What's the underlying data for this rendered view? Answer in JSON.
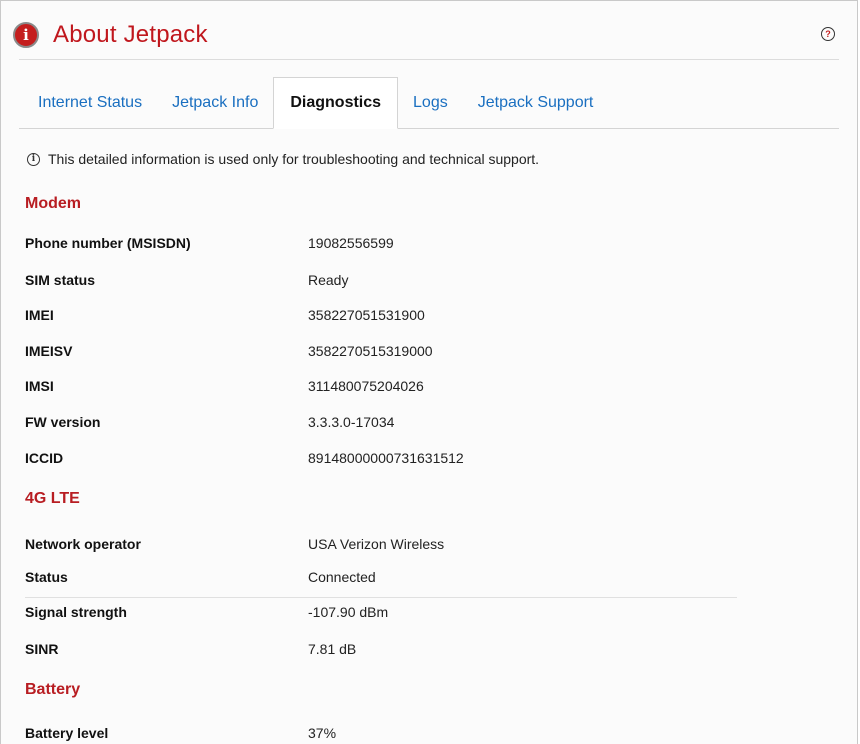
{
  "header": {
    "title": "About Jetpack",
    "info_icon": "info-icon",
    "help_icon": "question-circle-icon",
    "accent_color": "#c0171d"
  },
  "tabs": [
    {
      "label": "Internet Status",
      "active": false
    },
    {
      "label": "Jetpack Info",
      "active": false
    },
    {
      "label": "Diagnostics",
      "active": true
    },
    {
      "label": "Logs",
      "active": false
    },
    {
      "label": "Jetpack Support",
      "active": false
    }
  ],
  "notice": {
    "text": "This detailed information is used only for troubleshooting and technical support."
  },
  "sections": {
    "modem": {
      "title": "Modem",
      "rows": [
        {
          "label": "Phone number (MSISDN)",
          "value": "19082556599"
        },
        {
          "label": "SIM status",
          "value": "Ready"
        },
        {
          "label": "IMEI",
          "value": "358227051531900"
        },
        {
          "label": "IMEISV",
          "value": "3582270515319000"
        },
        {
          "label": "IMSI",
          "value": "311480075204026"
        },
        {
          "label": "FW version",
          "value": "3.3.3.0-17034"
        },
        {
          "label": "ICCID",
          "value": "89148000000731631512"
        }
      ]
    },
    "lte": {
      "title": "4G LTE",
      "rows": [
        {
          "label": "Network operator",
          "value": "USA Verizon Wireless"
        },
        {
          "label": "Status",
          "value": "Connected"
        },
        {
          "label": "Signal strength",
          "value": "-107.90 dBm"
        },
        {
          "label": "SINR",
          "value": "7.81 dB"
        }
      ]
    },
    "battery": {
      "title": "Battery",
      "rows": [
        {
          "label": "Battery level",
          "value": "37%"
        }
      ]
    }
  }
}
